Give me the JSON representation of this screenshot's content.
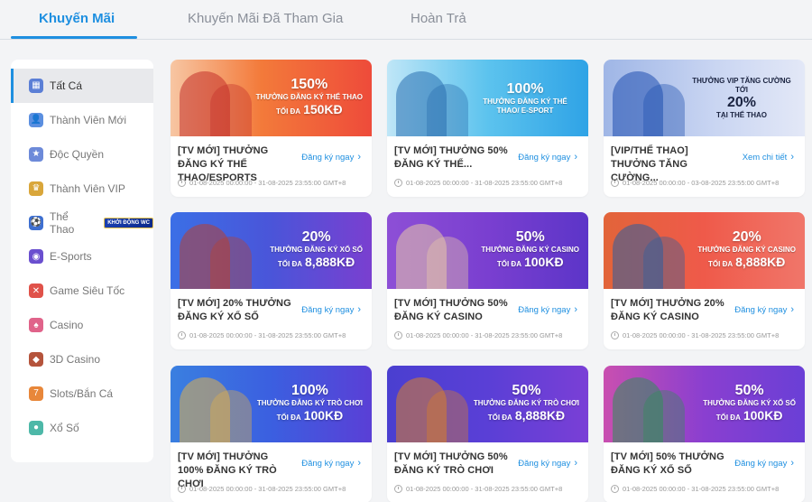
{
  "tabs": [
    {
      "label": "Khuyến Mãi",
      "active": true
    },
    {
      "label": "Khuyến Mãi Đã Tham Gia",
      "active": false
    },
    {
      "label": "Hoàn Trả",
      "active": false
    }
  ],
  "sidebar": {
    "items": [
      {
        "label": "Tất Cá",
        "icon": "grid-icon",
        "color": "#5b7fd6",
        "glyph": "▦",
        "active": true
      },
      {
        "label": "Thành Viên Mới",
        "icon": "user-icon",
        "color": "#5b8fe0",
        "glyph": "👤"
      },
      {
        "label": "Độc Quyền",
        "icon": "star-icon",
        "color": "#6d8ad9",
        "glyph": "★"
      },
      {
        "label": "Thành Viên VIP",
        "icon": "vip-crown-icon",
        "color": "#d9a63a",
        "glyph": "♛"
      },
      {
        "label": "Thể Thao",
        "icon": "sports-icon",
        "color": "#3e6fd0",
        "glyph": "⚽",
        "badge": "KHỞI ĐỘNG WC"
      },
      {
        "label": "E-Sports",
        "icon": "gamepad-icon",
        "color": "#6a4fcf",
        "glyph": "◉"
      },
      {
        "label": "Game Siêu Tốc",
        "icon": "fast-game-icon",
        "color": "#e0524a",
        "glyph": "✕"
      },
      {
        "label": "Casino",
        "icon": "casino-icon",
        "color": "#e0638a",
        "glyph": "♠"
      },
      {
        "label": "3D Casino",
        "icon": "3d-casino-icon",
        "color": "#b5543c",
        "glyph": "◆"
      },
      {
        "label": "Slots/Bắn Cá",
        "icon": "slots-icon",
        "color": "#e8873a",
        "glyph": "7"
      },
      {
        "label": "Xổ Số",
        "icon": "lottery-icon",
        "color": "#4db8a8",
        "glyph": "●"
      }
    ]
  },
  "cards": [
    {
      "title": "[TV MỚI] THƯỞNG ĐĂNG KÝ THỂ THAO/ESPORTS",
      "link": "Đăng ký ngay",
      "date": "01-08-2025 00:00:00 - 31-08-2025 23:55:00 GMT+8",
      "banner": {
        "big": "150%",
        "sub": "THƯỞNG ĐĂNG KÝ THỂ THAO",
        "max_prefix": "TỐI ĐA",
        "max": "150KĐ",
        "bg": "linear-gradient(90deg,#f7c6a3 0%,#f37a3a 45%,#ee4b3a 100%)",
        "fig": "#c2302a"
      }
    },
    {
      "title": "[TV MỚI] THƯỞNG 50% ĐĂNG KÝ THỂ...",
      "link": "Đăng ký ngay",
      "date": "01-08-2025 00:00:00 - 31-08-2025 23:55:00 GMT+8",
      "banner": {
        "big": "100%",
        "sub": "THƯỞNG ĐĂNG KÝ THỂ THAO/ E-SPORT",
        "max_prefix": "",
        "max": "",
        "bg": "linear-gradient(90deg,#bfe6f7 0%,#5cc3ee 50%,#2fa3e6 100%)",
        "fig": "#2a6fb0"
      }
    },
    {
      "title": "[VIP/THỂ THAO] THƯỞNG TĂNG CƯỜNG...",
      "link": "Xem chi tiết",
      "date": "01-08-2025 00:00:00 - 03-08-2025 23:55:00 GMT+8",
      "banner": {
        "big": "20%",
        "sub": "THƯỞNG VIP TĂNG CƯỜNG TỚI",
        "max_prefix": "",
        "max": "TẠI THỂ THAO",
        "bg": "linear-gradient(90deg,#9fb6e6 0%,#c9d5f2 55%,#e3e8f7 100%)",
        "fig": "#1f4fb0",
        "dark": true
      }
    },
    {
      "title": "[TV MỚI] 20% THƯỞNG ĐĂNG KÝ XỔ SỐ",
      "link": "Đăng ký ngay",
      "date": "01-08-2025 00:00:00 - 31-08-2025 23:55:00 GMT+8",
      "banner": {
        "big": "20%",
        "sub": "THƯỞNG ĐĂNG KÝ XỔ SỐ",
        "max_prefix": "TỐI ĐA",
        "max": "8,888KĐ",
        "bg": "linear-gradient(90deg,#3b6fe6 0%,#4a55d9 50%,#7a3fd0 100%)",
        "fig": "#b8402f"
      }
    },
    {
      "title": "[TV MỚI] THƯỞNG 50% ĐĂNG KÝ CASINO",
      "link": "Đăng ký ngay",
      "date": "01-08-2025 00:00:00 - 31-08-2025 23:55:00 GMT+8",
      "banner": {
        "big": "50%",
        "sub": "THƯỞNG ĐĂNG KÝ CASINO",
        "max_prefix": "TỐI ĐA",
        "max": "100KĐ",
        "bg": "linear-gradient(90deg,#8d4fd6 0%,#7a3fd0 50%,#5c35c8 100%)",
        "fig": "#e8c9a8"
      }
    },
    {
      "title": "[TV MỚI] THƯỞNG 20% ĐĂNG KÝ CASINO",
      "link": "Đăng ký ngay",
      "date": "01-08-2025 00:00:00 - 31-08-2025 23:55:00 GMT+8",
      "banner": {
        "big": "20%",
        "sub": "THƯỞNG ĐĂNG KÝ CASINO",
        "max_prefix": "TỐI ĐA",
        "max": "8,888KĐ",
        "bg": "linear-gradient(90deg,#e2643a 0%,#ef5a4a 50%,#f0766a 100%)",
        "fig": "#2a5fa0"
      }
    },
    {
      "title": "[TV MỚI] THƯỞNG 100% ĐĂNG KÝ TRÒ CHƠI",
      "link": "Đăng ký ngay",
      "date": "01-08-2025 00:00:00 - 31-08-2025 23:55:00 GMT+8",
      "banner": {
        "big": "100%",
        "sub": "THƯỞNG ĐĂNG KÝ TRÒ CHƠI",
        "max_prefix": "TỐI ĐA",
        "max": "100KĐ",
        "bg": "linear-gradient(90deg,#3a7fe0 0%,#3b5fe0 50%,#5a3fd6 100%)",
        "fig": "#e0b04a"
      }
    },
    {
      "title": "[TV MỚI] THƯỞNG 50% ĐĂNG KÝ TRÒ CHƠI",
      "link": "Đăng ký ngay",
      "date": "01-08-2025 00:00:00 - 31-08-2025 23:55:00 GMT+8",
      "banner": {
        "big": "50%",
        "sub": "THƯỞNG ĐĂNG KÝ TRÒ CHƠI",
        "max_prefix": "TỐI ĐA",
        "max": "8,888KĐ",
        "bg": "linear-gradient(90deg,#4a3fd0 0%,#5a3fd6 50%,#7a3fd6 100%)",
        "fig": "#d9802a"
      }
    },
    {
      "title": "[TV MỚI] 50% THƯỞNG ĐĂNG KÝ XỔ SỐ",
      "link": "Đăng ký ngay",
      "date": "01-08-2025 00:00:00 - 31-08-2025 23:55:00 GMT+8",
      "banner": {
        "big": "50%",
        "sub": "THƯỞNG ĐĂNG KÝ XỔ SỐ",
        "max_prefix": "TỐI ĐA",
        "max": "100KĐ",
        "bg": "linear-gradient(90deg,#c94fb0 0%,#8a3fd0 50%,#6a3fd6 100%)",
        "fig": "#2f8f5a"
      }
    }
  ]
}
